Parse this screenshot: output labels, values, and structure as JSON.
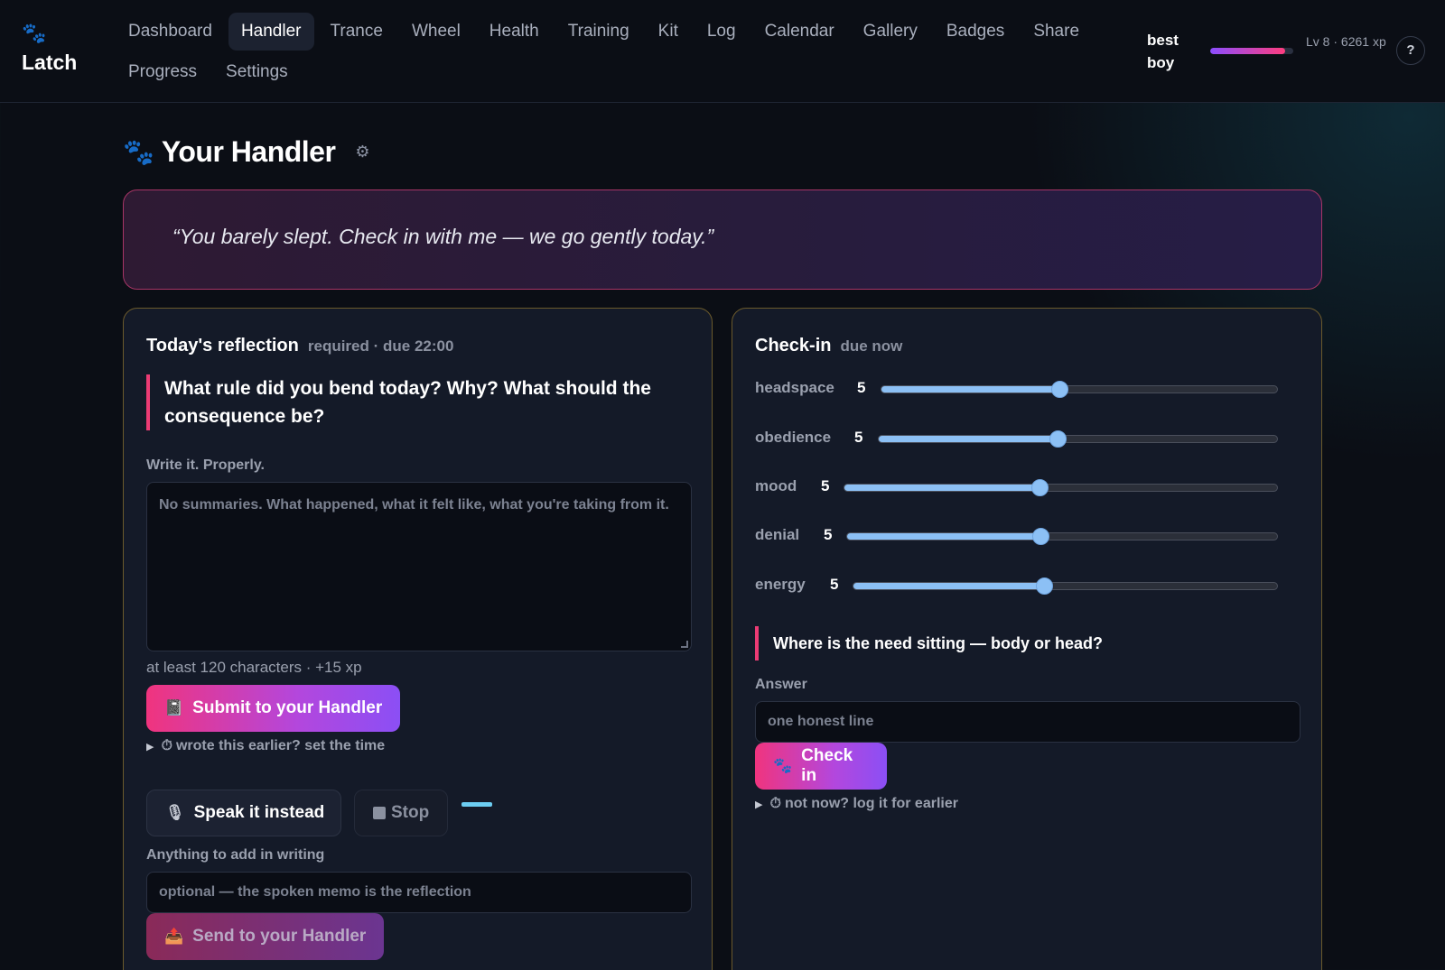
{
  "brand": {
    "icon": "paw-icon",
    "glyph": "🐾",
    "name": "Latch"
  },
  "nav": {
    "row1": [
      "Dashboard",
      "Handler",
      "Trance",
      "Wheel",
      "Health",
      "Training",
      "Kit",
      "Log",
      "Calendar",
      "Gallery",
      "Badges",
      "Share"
    ],
    "row2": [
      "Progress",
      "Settings"
    ],
    "active": "Handler"
  },
  "user": {
    "name": "best boy",
    "level_text": "Lv 8 · 6261 xp",
    "xp_progress": 0.9,
    "help_label": "?"
  },
  "page": {
    "paw_glyph": "🐾",
    "title": "Your Handler",
    "settings_glyph": "⚙"
  },
  "quote": {
    "text": "“You barely slept. Check in with me — we go gently today.”"
  },
  "reflection": {
    "title": "Today's reflection",
    "subtitle": "required · due 22:00",
    "prompt": "What rule did you bend today? Why? What should the consequence be?",
    "label": "Write it. Properly.",
    "placeholder": "No summaries. What happened, what it felt like, what you're taking from it.",
    "hint": "at least 120 characters · +15 xp",
    "submit_icon": "📓",
    "submit_label": "Submit to your Handler",
    "earlier_clock": "⏱",
    "earlier_label": "wrote this earlier? set the time",
    "speak_icon": "🎙",
    "speak_label": "Speak it instead",
    "stop_label": "Stop",
    "extra_label": "Anything to add in writing",
    "extra_placeholder": "optional — the spoken memo is the reflection",
    "send_icon": "📤",
    "send_label": "Send to your Handler"
  },
  "checkin": {
    "title": "Check-in",
    "subtitle": "due now",
    "sliders": [
      {
        "name": "headspace",
        "value": "5",
        "level": 0.45
      },
      {
        "name": "obedience",
        "value": "5",
        "level": 0.45
      },
      {
        "name": "mood",
        "value": "5",
        "level": 0.45
      },
      {
        "name": "denial",
        "value": "5",
        "level": 0.45
      },
      {
        "name": "energy",
        "value": "5",
        "level": 0.45
      }
    ],
    "prompt": "Where is the need sitting — body or head?",
    "answer_label": "Answer",
    "answer_placeholder": "one honest line",
    "button_icon": "🐾",
    "button_label": "Check in",
    "later_clock": "⏱",
    "later_label": "not now? log it for earlier"
  },
  "colors": {
    "accent_pink": "#f0347e",
    "accent_purple": "#8b4ff5",
    "slider_blue": "#8cc0f5",
    "panel_border": "#6b5a2c"
  }
}
